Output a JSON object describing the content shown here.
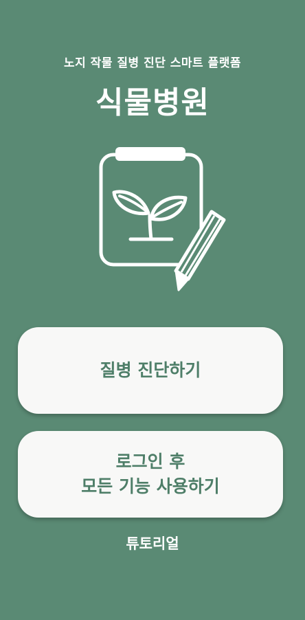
{
  "header": {
    "subtitle": "노지 작물 질병 진단 스마트 플랫폼",
    "title": "식물병원"
  },
  "logo": {
    "icon": "clipboard-plant-pencil-icon"
  },
  "buttons": {
    "diagnose_label": "질병 진단하기",
    "login_line1": "로그인 후",
    "login_line2": "모든 기능 사용하기"
  },
  "footer": {
    "tutorial_label": "튜토리얼"
  },
  "colors": {
    "background": "#5a8a74",
    "button_background": "#f8f8f7",
    "button_text": "#4e7e68",
    "text": "#ffffff"
  }
}
